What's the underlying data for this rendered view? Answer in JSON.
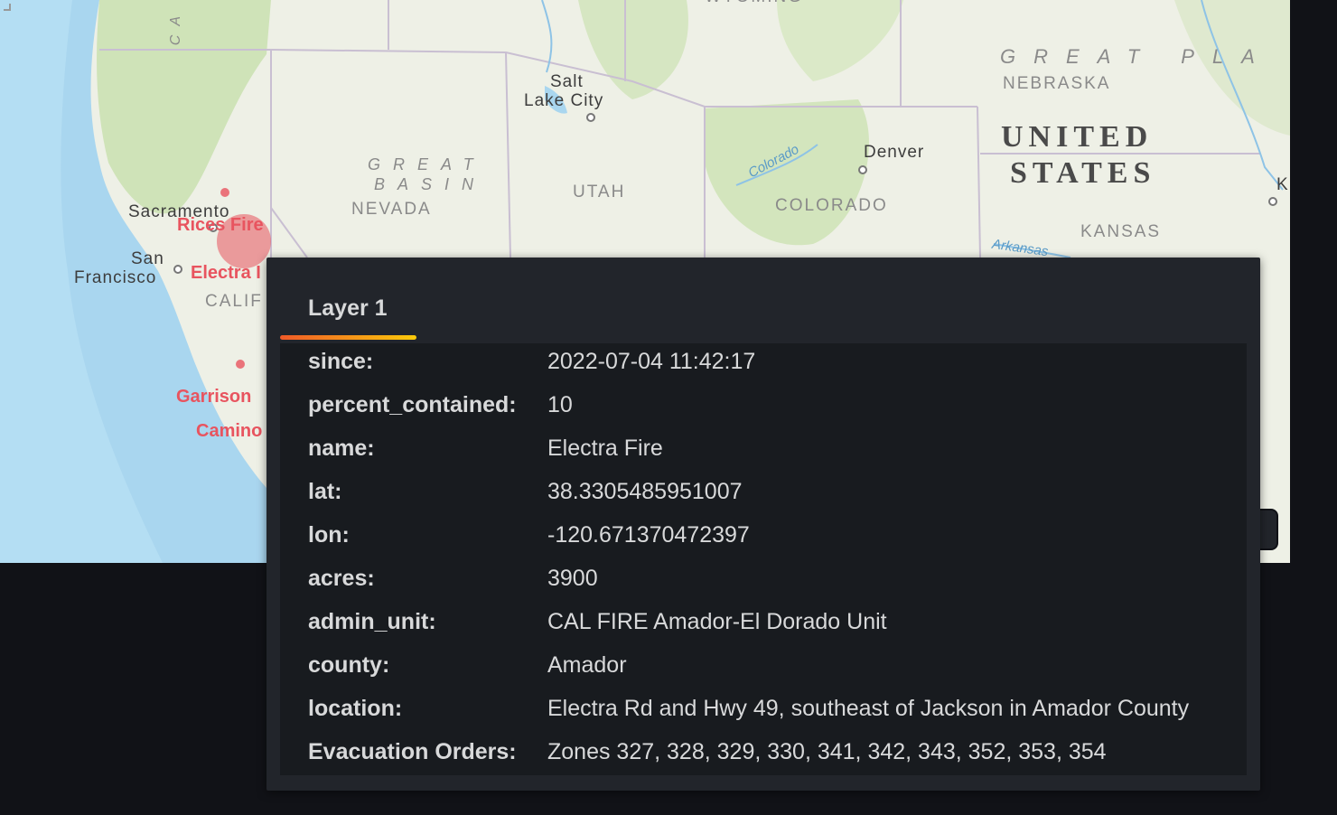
{
  "map": {
    "cities": {
      "salt_lake_1": "Salt",
      "salt_lake_2": "Lake City",
      "denver": "Denver",
      "sacramento": "Sacramento",
      "sf_1": "San",
      "sf_2": "Francisco"
    },
    "states": {
      "nevada": "NEVADA",
      "utah": "UTAH",
      "colorado": "COLORADO",
      "nebraska": "NEBRASKA",
      "kansas": "KANSAS",
      "calif": "CALIF",
      "wyoming": "WYOMING"
    },
    "regions": {
      "great_basin_1": "GREAT",
      "great_basin_2": "BASIN",
      "great_plains": "GREAT PLA",
      "ca_partial": "CA"
    },
    "country": {
      "line1": "UNITED",
      "line2": "STATES"
    },
    "rivers": {
      "colorado": "Colorado",
      "arkansas": "Arkansas"
    },
    "edge_label": "K",
    "fire_labels": {
      "rices": "Rices Fire",
      "electra": "Electra I",
      "garrison": "Garrison",
      "camino": "Camino"
    },
    "fire_color": "#e8545f"
  },
  "tooltip": {
    "tab_label": "Layer 1",
    "rows": [
      {
        "key": "since:",
        "value": "2022-07-04 11:42:17"
      },
      {
        "key": "percent_contained:",
        "value": "10"
      },
      {
        "key": "name:",
        "value": "Electra Fire"
      },
      {
        "key": "lat:",
        "value": "38.3305485951007"
      },
      {
        "key": "lon:",
        "value": "-120.671370472397"
      },
      {
        "key": "acres:",
        "value": "3900"
      },
      {
        "key": "admin_unit:",
        "value": "CAL FIRE Amador-El Dorado Unit"
      },
      {
        "key": "county:",
        "value": "Amador"
      },
      {
        "key": "location:",
        "value": "Electra Rd and Hwy 49, southeast of Jackson in Amador County"
      },
      {
        "key": "Evacuation Orders:",
        "value": "Zones 327, 328, 329, 330, 341, 342, 343, 352, 353, 354"
      }
    ]
  },
  "colors": {
    "background": "#111217",
    "panel": "#22252b",
    "panel_inner": "#181b1f",
    "text": "#d8d9da",
    "tab_accent": "#f05a28"
  }
}
